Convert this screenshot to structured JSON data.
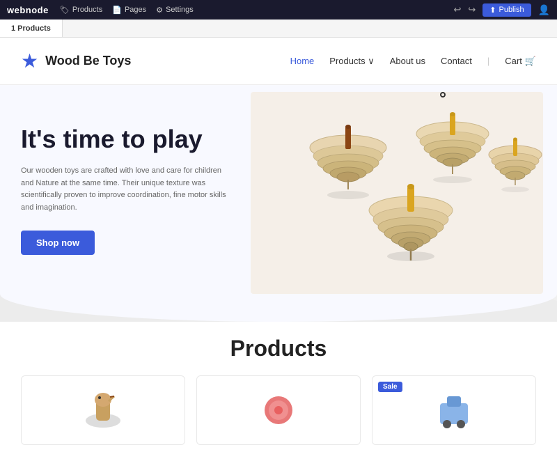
{
  "toolbar": {
    "brand": "webnode",
    "nav_items": [
      {
        "label": "Products",
        "icon": "tag-icon"
      },
      {
        "label": "Pages",
        "icon": "pages-icon"
      },
      {
        "label": "Settings",
        "icon": "settings-icon"
      }
    ],
    "undo_icon": "undo-icon",
    "redo_icon": "redo-icon",
    "publish_label": "Publish",
    "user_icon": "user-icon"
  },
  "tabbar": {
    "tabs": [
      {
        "label": "1 Products",
        "active": true
      }
    ]
  },
  "site_nav": {
    "logo_text": "Wood Be Toys",
    "links": [
      {
        "label": "Home",
        "active": true
      },
      {
        "label": "Products",
        "has_dropdown": true
      },
      {
        "label": "About us"
      },
      {
        "label": "Contact"
      },
      {
        "label": "Cart"
      }
    ]
  },
  "hero": {
    "title": "It's time to play",
    "description": "Our wooden toys are crafted with love and care for children and Nature at the same time. Their unique texture was scientifically proven to improve coordination, fine motor skills and imagination.",
    "button_label": "Shop now"
  },
  "products": {
    "section_title": "Products",
    "items": [
      {
        "has_sale": false,
        "placeholder": "product-1"
      },
      {
        "has_sale": false,
        "placeholder": "product-2"
      },
      {
        "has_sale": true,
        "sale_label": "Sale",
        "placeholder": "product-3"
      }
    ]
  },
  "colors": {
    "brand_blue": "#3b5bdb",
    "toolbar_bg": "#1a1a2e",
    "hero_bg": "#f8f9ff"
  }
}
